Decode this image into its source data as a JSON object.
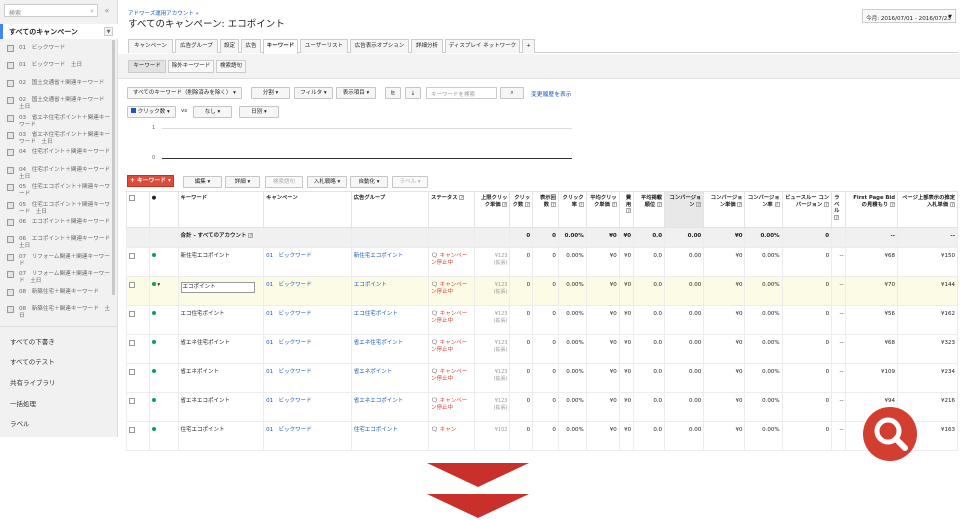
{
  "sidebar": {
    "search_placeholder": "検索",
    "all_campaigns": "すべてのキャンペーン",
    "campaigns": [
      "01　ビックワード",
      "01　ビックワード　土日",
      "02　国土交通省＋関連キーワード",
      "02　国土交通省＋関連キーワード　土日",
      "03　省エネ住宅ポイント＋関連キーワード",
      "03　省エネ住宅ポイント＋関連キーワード　土日",
      "04　住宅ポイント＋関連キーワード",
      "04　住宅ポイント＋関連キーワード　土日",
      "05　住宅エコポイント＋関連キーワード",
      "05　住宅エコポイント＋関連キーワード　土日",
      "06　エコポイント＋関連キーワード",
      "06　エコポイント＋関連キーワード　土日",
      "07　リフォーム関連＋関連キーワード",
      "07　リフォーム関連＋関連キーワード　土日",
      "08　新築住宅＋関連キーワード",
      "08　新築住宅＋関連キーワード　土日"
    ],
    "links": [
      "すべての下書き",
      "すべてのテスト",
      "共有ライブラリ",
      "一括処理",
      "ラベル"
    ]
  },
  "header": {
    "breadcrumb": "アドワーズ運用アカウント »",
    "title": "すべてのキャンペーン: エコポイント",
    "date_range": "今月: 2016/07/01 - 2016/07/23"
  },
  "tabs": [
    "キャンペーン",
    "広告グループ",
    "設定",
    "広告",
    "キーワード",
    "ユーザーリスト",
    "広告表示オプション",
    "詳細分析",
    "ディスプレイ ネットワーク",
    "+"
  ],
  "subtabs": [
    "キーワード",
    "除外キーワード",
    "検索語句"
  ],
  "toolbar": {
    "filter_all": "すべてのキーワード（削除済みを除く）",
    "segment": "分割",
    "filter": "フィルタ",
    "columns": "表示項目",
    "search_placeholder": "キーワードを検索",
    "change_history": "変更履歴を表示",
    "metric1": "クリック数",
    "vs": "vs",
    "metric2": "なし",
    "period": "日別"
  },
  "chart_axis": [
    "1",
    "0"
  ],
  "actions": {
    "add_keyword": "キーワード",
    "edit": "編集",
    "details": "詳細",
    "search_terms": "検索語句",
    "bid_strategy": "入札戦略",
    "automate": "自動化",
    "label": "ラベル"
  },
  "table": {
    "headers": [
      "キーワード",
      "キャンペーン",
      "広告グループ",
      "ステータス",
      "上限クリック単価",
      "クリック数",
      "表示回数",
      "クリック率",
      "平均クリック単価",
      "費用",
      "平均掲載順位",
      "コンバージョン",
      "コンバージョン単価",
      "コンバージョン率",
      "ビュースルー コンバージョン",
      "ラベル",
      "First Page Bid の見積もり",
      "ページ上部表示の推定入札単価"
    ],
    "total_label": "合計 - すべてのアカウント",
    "total": [
      "",
      "",
      "",
      "0",
      "0",
      "0.00%",
      "¥0",
      "¥0",
      "0.0",
      "0.00",
      "¥0",
      "0.00%",
      "0",
      "",
      "--",
      "--"
    ],
    "rows": [
      {
        "kw": "新住宅エコポイント",
        "camp": "01　ビックワード",
        "ag": "新住宅エコポイント",
        "status": "キャンペーン停止中",
        "bid": "¥123\n(拡張)",
        "vals": [
          "0",
          "0",
          "0.00%",
          "¥0",
          "¥0",
          "0.0",
          "0.00",
          "¥0",
          "0.00%",
          "0",
          "--",
          "¥68",
          "¥150"
        ]
      },
      {
        "kw": "エコポイント",
        "camp": "01　ビックワード",
        "ag": "エコポイント",
        "status": "キャンペーン停止中",
        "bid": "¥123\n(拡張)",
        "vals": [
          "0",
          "0",
          "0.00%",
          "¥0",
          "¥0",
          "0.0",
          "0.00",
          "¥0",
          "0.00%",
          "0",
          "--",
          "¥70",
          "¥144"
        ]
      },
      {
        "kw": "エコ住宅ポイント",
        "camp": "01　ビックワード",
        "ag": "エコ住宅ポイント",
        "status": "キャンペーン停止中",
        "bid": "¥123\n(拡張)",
        "vals": [
          "0",
          "0",
          "0.00%",
          "¥0",
          "¥0",
          "0.0",
          "0.00",
          "¥0",
          "0.00%",
          "0",
          "--",
          "¥56",
          "¥162"
        ]
      },
      {
        "kw": "省エネ住宅ポイント",
        "camp": "01　ビックワード",
        "ag": "省エネ住宅ポイント",
        "status": "キャンペーン停止中",
        "bid": "¥123\n(拡張)",
        "vals": [
          "0",
          "0",
          "0.00%",
          "¥0",
          "¥0",
          "0.0",
          "0.00",
          "¥0",
          "0.00%",
          "0",
          "--",
          "¥68",
          "¥323"
        ]
      },
      {
        "kw": "省エネポイント",
        "camp": "01　ビックワード",
        "ag": "省エネポイント",
        "status": "キャンペーン停止中",
        "bid": "¥123\n(拡張)",
        "vals": [
          "0",
          "0",
          "0.00%",
          "¥0",
          "¥0",
          "0.0",
          "0.00",
          "¥0",
          "0.00%",
          "0",
          "--",
          "¥109",
          "¥234"
        ]
      },
      {
        "kw": "省エネエコポイント",
        "camp": "01　ビックワード",
        "ag": "省エネエコポイント",
        "status": "キャンペーン停止中",
        "bid": "¥123\n(拡張)",
        "vals": [
          "0",
          "0",
          "0.00%",
          "¥0",
          "¥0",
          "0.0",
          "0.00",
          "¥0",
          "0.00%",
          "0",
          "--",
          "¥94",
          "¥216"
        ]
      },
      {
        "kw": "住宅エコポイント",
        "camp": "01　ビックワード",
        "ag": "住宅エコポイント",
        "status": "キャン",
        "bid": "¥102",
        "vals": [
          "0",
          "0",
          "0.00%",
          "¥0",
          "¥0",
          "0.0",
          "0.00",
          "¥0",
          "0.00%",
          "0",
          "--",
          "",
          "¥163"
        ]
      }
    ]
  },
  "colors": {
    "accent": "#dd4b39",
    "link": "#1a57b8",
    "overlay": "#c9302c"
  }
}
